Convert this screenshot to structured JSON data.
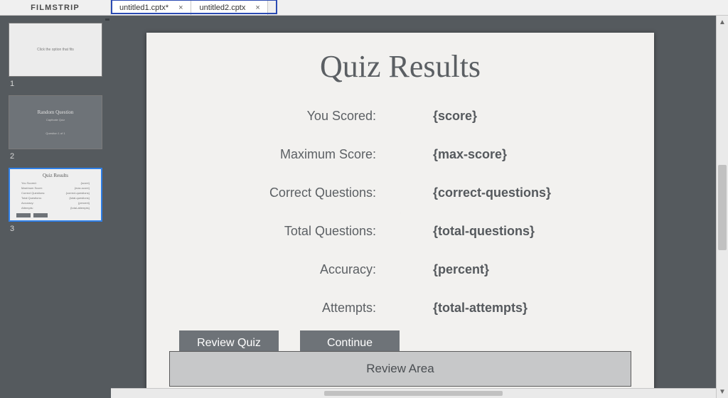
{
  "topbar": {
    "filmstrip_label": "FILMSTRIP",
    "tabs": [
      {
        "label": "untitled1.cptx*"
      },
      {
        "label": "untitled2.cptx"
      }
    ],
    "close_glyph": "×"
  },
  "filmstrip": {
    "thumb_numbers": [
      "1",
      "2",
      "3"
    ],
    "thumb2": {
      "title": "Random Question",
      "sub": "Captivate Quiz",
      "foot": "Question 1 of 1"
    },
    "thumb3_title": "Quiz Results"
  },
  "slide": {
    "title": "Quiz Results",
    "rows": [
      {
        "label": "You Scored:",
        "value": "{score}"
      },
      {
        "label": "Maximum Score:",
        "value": "{max-score}"
      },
      {
        "label": "Correct Questions:",
        "value": "{correct-questions}"
      },
      {
        "label": "Total Questions:",
        "value": "{total-questions}"
      },
      {
        "label": "Accuracy:",
        "value": "{percent}"
      },
      {
        "label": "Attempts:",
        "value": "{total-attempts}"
      }
    ],
    "buttons": {
      "review": "Review Quiz",
      "continue": "Continue"
    },
    "review_area": "Review Area"
  }
}
